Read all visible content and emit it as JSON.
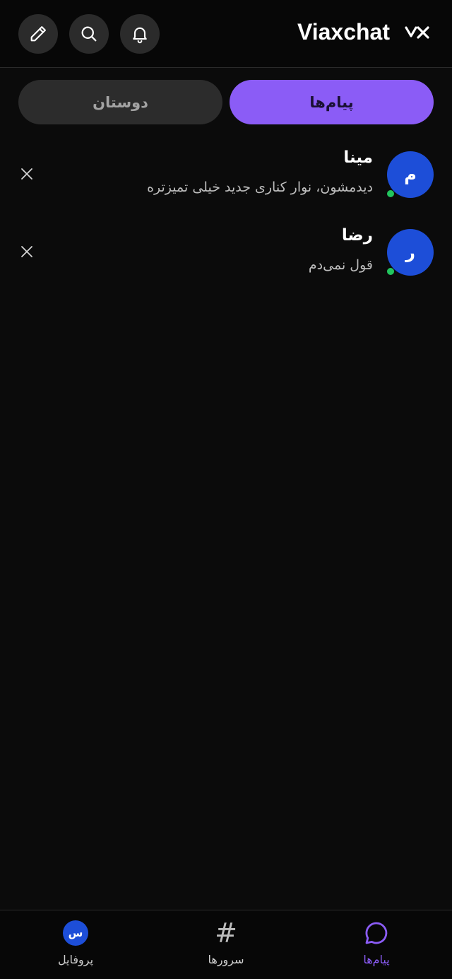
{
  "header": {
    "app_title": "Viaxchat",
    "logo_icon": "viaxchat-logo-icon",
    "actions": [
      {
        "name": "edit",
        "icon": "pencil-icon"
      },
      {
        "name": "search",
        "icon": "search-icon"
      },
      {
        "name": "notifications",
        "icon": "bell-icon"
      }
    ]
  },
  "tabs": {
    "messages": "پیام‌ها",
    "friends": "دوستان",
    "active": "messages"
  },
  "conversations": [
    {
      "initial": "م",
      "name": "مینا",
      "last_message": "دیدمشون، نوار کناری جدید خیلی تمیزتره",
      "online": true
    },
    {
      "initial": "ر",
      "name": "رضا",
      "last_message": "قول نمی‌دم",
      "online": true
    }
  ],
  "bottom_nav": {
    "messages": "پیام‌ها",
    "servers": "سرورها",
    "profile": "پروفایل",
    "profile_initial": "س",
    "active": "messages"
  },
  "colors": {
    "background": "#0b0b0b",
    "accent": "#8b5cf6",
    "avatar": "#1d4ed8",
    "online": "#22c55e"
  }
}
